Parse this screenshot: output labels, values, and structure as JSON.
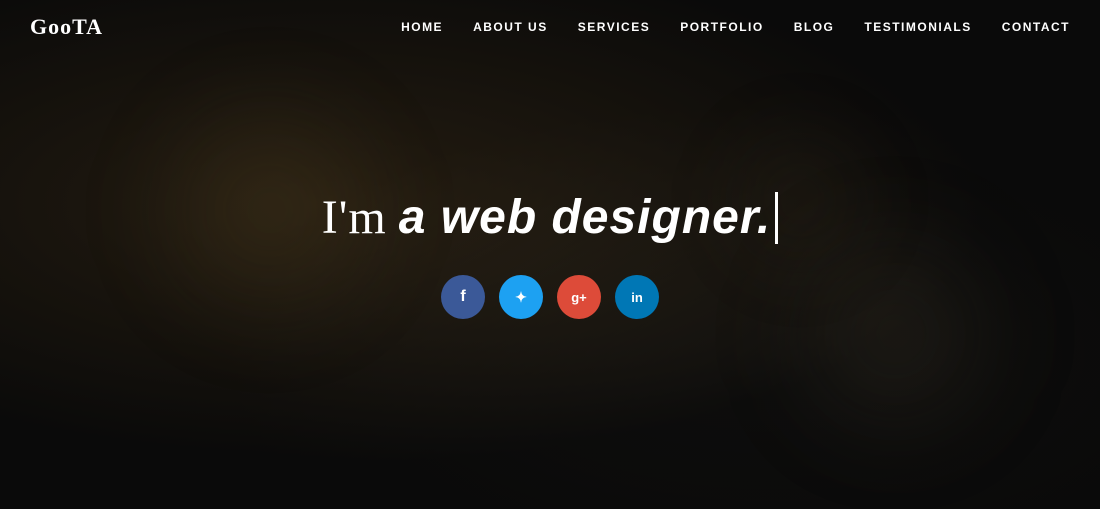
{
  "logo": {
    "text": "GooTA"
  },
  "navbar": {
    "links": [
      {
        "label": "HOME",
        "id": "nav-home"
      },
      {
        "label": "ABOUT US",
        "id": "nav-about"
      },
      {
        "label": "SERVICES",
        "id": "nav-services"
      },
      {
        "label": "PORTFOLIO",
        "id": "nav-portfolio"
      },
      {
        "label": "BLOG",
        "id": "nav-blog"
      },
      {
        "label": "TESTIMONIALS",
        "id": "nav-testimonials"
      },
      {
        "label": "CONTACT",
        "id": "nav-contact"
      }
    ]
  },
  "hero": {
    "headline_light": "I'm",
    "headline_bold": "a web designer.",
    "social": [
      {
        "id": "facebook",
        "icon": "f",
        "label": "Facebook",
        "color": "facebook"
      },
      {
        "id": "twitter",
        "icon": "t",
        "label": "Twitter",
        "color": "twitter"
      },
      {
        "id": "google",
        "icon": "g+",
        "label": "Google Plus",
        "color": "google"
      },
      {
        "id": "linkedin",
        "icon": "in",
        "label": "LinkedIn",
        "color": "linkedin"
      }
    ]
  }
}
